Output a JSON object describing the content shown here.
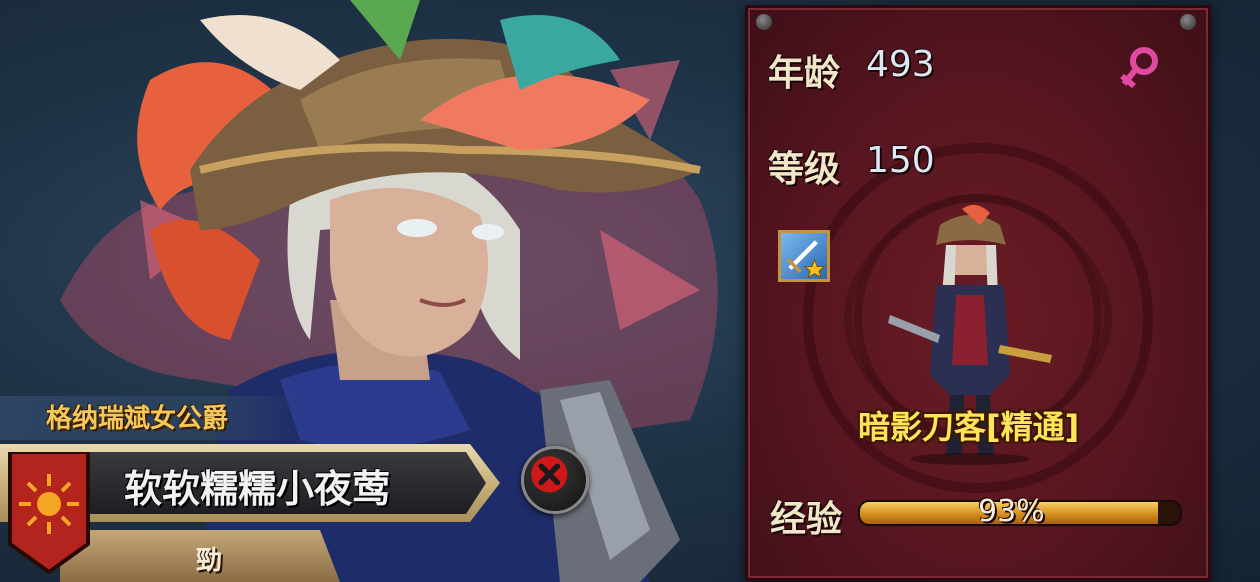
{
  "character": {
    "title": "格纳瑞斌女公爵",
    "name": "软软糯糯小夜莺",
    "guild": "勁"
  },
  "stats": {
    "age_label": "年龄",
    "age_value": "493",
    "level_label": "等级",
    "level_value": "150",
    "class_name": "暗影刀客[精通]",
    "exp_label": "经验",
    "exp_value": "93%",
    "exp_fraction": 0.93
  },
  "icons": {
    "gender": "female-symbol-icon",
    "skill": "sword-star-icon",
    "close": "close-x-icon",
    "crest": "sun-banner-icon"
  },
  "colors": {
    "panel": "#561520",
    "title_gold": "#f4c95a",
    "class_yellow": "#ffe45a",
    "gender_pink": "#e04aa0"
  }
}
